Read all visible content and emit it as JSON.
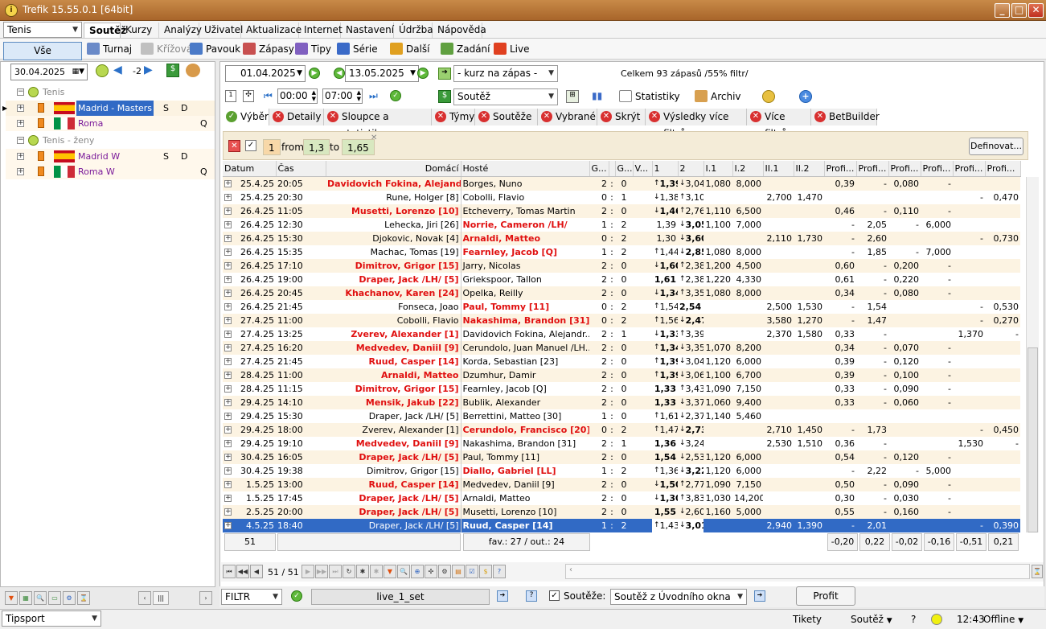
{
  "window": {
    "title": "Trefik 15.55.0.1 [64bit]",
    "min": "_",
    "max": "□",
    "close": "✕"
  },
  "sport_select": "Tenis",
  "menu": [
    "Soutěž",
    "Kurzy",
    "Analýzy",
    "Uživatel",
    "Aktualizace",
    "Internet",
    "Nastavení",
    "Údržba",
    "Nápověda"
  ],
  "toolbar": {
    "vse": "Vše",
    "items": [
      "Turnaj",
      "Křížová",
      "Pavouk",
      "Zápasy",
      "Tipy",
      "Série",
      "Další",
      "Zadání",
      "Live"
    ]
  },
  "left": {
    "date": "30.04.2025",
    "offset": "-2",
    "groups": [
      {
        "name": "Tenis",
        "items": [
          {
            "name": "Madrid - Masters",
            "s": "S",
            "d": "D",
            "flag": "es",
            "selected": true
          },
          {
            "name": "Roma",
            "s": "",
            "d": "Q",
            "flag": "it"
          }
        ]
      },
      {
        "name": "Tenis - ženy",
        "items": [
          {
            "name": "Madrid W",
            "s": "S",
            "d": "D",
            "flag": "es"
          },
          {
            "name": "Roma W",
            "s": "",
            "d": "Q",
            "flag": "it"
          }
        ]
      }
    ]
  },
  "filterbar": {
    "date_from": "01.04.2025",
    "date_to": "13.05.2025",
    "kurz": "- kurz na zápas -",
    "summary": "Celkem 93 zápasů /55% filtr/",
    "time_from": "00:00",
    "time_to": "07:00",
    "soutez": "Soutěž",
    "statistiky": "Statistiky",
    "archiv": "Archiv"
  },
  "tabs": [
    "Výběr",
    "Detaily",
    "Sloupce a statistiky",
    "Týmy",
    "Soutěže",
    "Vybrané",
    "Skrýt",
    "Výsledky více filtrů",
    "Více filtrů",
    "BetBuilder"
  ],
  "filter": {
    "num": "1",
    "from": "from",
    "v1": "1,3",
    "to": "to",
    "v2": "1,65",
    "define": "Definovat..."
  },
  "columns": [
    "Datum",
    "Čas",
    "Domácí",
    "Hosté",
    "G...",
    "",
    "G...",
    "V...",
    "1",
    "2",
    "I.1",
    "I.2",
    "II.1",
    "II.2",
    "Profi...",
    "Profi...",
    "Profi...",
    "Profi...",
    "Profi...",
    "Profi..."
  ],
  "rows": [
    {
      "date": "25.4.25",
      "time": "20:05",
      "home": "Davidovich Fokina, Alejandr...",
      "away": "Borges, Nuno",
      "hb": true,
      "ab": false,
      "g1": "2",
      "g2": "0",
      "o1": "1,39",
      "o1b": true,
      "a1": "↑",
      "o2": "3,04",
      "a2": "↓",
      "o2b": false,
      "i1": "1,080",
      "i2": "8,000",
      "ii1": "",
      "ii2": "",
      "p": [
        "0,39",
        "-",
        "0,080",
        "-",
        "",
        ""
      ]
    },
    {
      "date": "25.4.25",
      "time": "20:30",
      "home": "Rune, Holger [8]",
      "away": "Cobolli, Flavio",
      "hb": false,
      "ab": false,
      "g1": "0",
      "g2": "1",
      "o1": "1,38",
      "o1b": false,
      "a1": "↓",
      "o2": "3,10",
      "a2": "↑",
      "o2b": false,
      "i1": "",
      "i2": "",
      "ii1": "2,700",
      "ii2": "1,470",
      "p": [
        "",
        "",
        "",
        "",
        "-",
        "0,470"
      ]
    },
    {
      "date": "26.4.25",
      "time": "11:05",
      "home": "Musetti, Lorenzo [10]",
      "away": "Etcheverry, Tomas Martin",
      "hb": true,
      "ab": false,
      "g1": "2",
      "g2": "0",
      "o1": "1,46",
      "o1b": true,
      "a1": "↓",
      "o2": "2,76",
      "a2": "↑",
      "o2b": false,
      "i1": "1,110",
      "i2": "6,500",
      "ii1": "",
      "ii2": "",
      "p": [
        "0,46",
        "-",
        "0,110",
        "-",
        "",
        ""
      ]
    },
    {
      "date": "26.4.25",
      "time": "12:30",
      "home": "Lehecka, Jiri [26]",
      "away": "Norrie, Cameron /LH/",
      "hb": false,
      "ab": true,
      "g1": "1",
      "g2": "2",
      "o1": "1,39",
      "o1b": false,
      "a1": "",
      "o2": "3,05",
      "a2": "↓",
      "o2b": true,
      "i1": "1,100",
      "i2": "7,000",
      "ii1": "",
      "ii2": "",
      "p": [
        "-",
        "2,05",
        "-",
        "6,000",
        "",
        ""
      ]
    },
    {
      "date": "26.4.25",
      "time": "15:30",
      "home": "Djokovic, Novak [4]",
      "away": "Arnaldi, Matteo",
      "hb": false,
      "ab": true,
      "g1": "0",
      "g2": "2",
      "o1": "1,30",
      "o1b": false,
      "a1": "",
      "o2": "3,60",
      "a2": "↓",
      "o2b": true,
      "i1": "",
      "i2": "",
      "ii1": "2,110",
      "ii2": "1,730",
      "p": [
        "-",
        "2,60",
        "",
        "",
        "-",
        "0,730"
      ]
    },
    {
      "date": "26.4.25",
      "time": "15:35",
      "home": "Machac, Tomas [19]",
      "away": "Fearnley, Jacob [Q]",
      "hb": false,
      "ab": true,
      "g1": "1",
      "g2": "2",
      "o1": "1,44",
      "o1b": false,
      "a1": "↑",
      "o2": "2,85",
      "a2": "↓",
      "o2b": true,
      "i1": "1,080",
      "i2": "8,000",
      "ii1": "",
      "ii2": "",
      "p": [
        "-",
        "1,85",
        "-",
        "7,000",
        "",
        ""
      ]
    },
    {
      "date": "26.4.25",
      "time": "17:10",
      "home": "Dimitrov, Grigor [15]",
      "away": "Jarry, Nicolas",
      "hb": true,
      "ab": false,
      "g1": "2",
      "g2": "0",
      "o1": "1,60",
      "o1b": true,
      "a1": "↓",
      "o2": "2,38",
      "a2": "↑",
      "o2b": false,
      "i1": "1,200",
      "i2": "4,500",
      "ii1": "",
      "ii2": "",
      "p": [
        "0,60",
        "-",
        "0,200",
        "-",
        "",
        ""
      ]
    },
    {
      "date": "26.4.25",
      "time": "19:00",
      "home": "Draper, Jack /LH/ [5]",
      "away": "Griekspoor, Tallon",
      "hb": true,
      "ab": false,
      "g1": "2",
      "g2": "0",
      "o1": "1,61",
      "o1b": true,
      "a1": "",
      "o2": "2,38",
      "a2": "↑",
      "o2b": false,
      "i1": "1,220",
      "i2": "4,330",
      "ii1": "",
      "ii2": "",
      "p": [
        "0,61",
        "-",
        "0,220",
        "-",
        "",
        ""
      ]
    },
    {
      "date": "26.4.25",
      "time": "20:45",
      "home": "Khachanov, Karen [24]",
      "away": "Opelka, Reilly",
      "hb": true,
      "ab": false,
      "g1": "2",
      "g2": "0",
      "o1": "1,34",
      "o1b": true,
      "a1": "↓",
      "o2": "3,35",
      "a2": "↑",
      "o2b": false,
      "i1": "1,080",
      "i2": "8,000",
      "ii1": "",
      "ii2": "",
      "p": [
        "0,34",
        "-",
        "0,080",
        "-",
        "",
        ""
      ]
    },
    {
      "date": "26.4.25",
      "time": "21:45",
      "home": "Fonseca, Joao",
      "away": "Paul, Tommy [11]",
      "hb": false,
      "ab": true,
      "g1": "0",
      "g2": "2",
      "o1": "1,54",
      "o1b": false,
      "a1": "↑",
      "o2": "2,54",
      "a2": "",
      "o2b": true,
      "i1": "",
      "i2": "",
      "ii1": "2,500",
      "ii2": "1,530",
      "p": [
        "-",
        "1,54",
        "",
        "",
        "-",
        "0,530"
      ]
    },
    {
      "date": "27.4.25",
      "time": "11:00",
      "home": "Cobolli, Flavio",
      "away": "Nakashima, Brandon [31]",
      "hb": false,
      "ab": true,
      "g1": "0",
      "g2": "2",
      "o1": "1,56",
      "o1b": false,
      "a1": "↑",
      "o2": "2,47",
      "a2": "↓",
      "o2b": true,
      "i1": "",
      "i2": "",
      "ii1": "3,580",
      "ii2": "1,270",
      "p": [
        "-",
        "1,47",
        "",
        "",
        "-",
        "0,270"
      ]
    },
    {
      "date": "27.4.25",
      "time": "13:25",
      "home": "Zverev, Alexander [1]",
      "away": "Davidovich Fokina, Alejandr...",
      "hb": true,
      "ab": false,
      "g1": "2",
      "g2": "1",
      "o1": "1,33",
      "o1b": true,
      "a1": "↓",
      "o2": "3,39",
      "a2": "↑",
      "o2b": false,
      "i1": "",
      "i2": "",
      "ii1": "2,370",
      "ii2": "1,580",
      "p": [
        "0,33",
        "-",
        "",
        "",
        "1,370",
        "-"
      ]
    },
    {
      "date": "27.4.25",
      "time": "16:20",
      "home": "Medvedev, Daniil [9]",
      "away": "Cerundolo, Juan Manuel /LH...",
      "hb": true,
      "ab": false,
      "g1": "2",
      "g2": "0",
      "o1": "1,34",
      "o1b": true,
      "a1": "↑",
      "o2": "3,35",
      "a2": "↓",
      "o2b": false,
      "i1": "1,070",
      "i2": "8,200",
      "ii1": "",
      "ii2": "",
      "p": [
        "0,34",
        "-",
        "0,070",
        "-",
        "",
        ""
      ]
    },
    {
      "date": "27.4.25",
      "time": "21:45",
      "home": "Ruud, Casper [14]",
      "away": "Korda, Sebastian [23]",
      "hb": true,
      "ab": false,
      "g1": "2",
      "g2": "0",
      "o1": "1,39",
      "o1b": true,
      "a1": "↑",
      "o2": "3,04",
      "a2": "↓",
      "o2b": false,
      "i1": "1,120",
      "i2": "6,000",
      "ii1": "",
      "ii2": "",
      "p": [
        "0,39",
        "-",
        "0,120",
        "-",
        "",
        ""
      ]
    },
    {
      "date": "28.4.25",
      "time": "11:00",
      "home": "Arnaldi, Matteo",
      "away": "Dzumhur, Damir",
      "hb": true,
      "ab": false,
      "g1": "2",
      "g2": "0",
      "o1": "1,39",
      "o1b": true,
      "a1": "↑",
      "o2": "3,06",
      "a2": "↓",
      "o2b": false,
      "i1": "1,100",
      "i2": "6,700",
      "ii1": "",
      "ii2": "",
      "p": [
        "0,39",
        "-",
        "0,100",
        "-",
        "",
        ""
      ]
    },
    {
      "date": "28.4.25",
      "time": "11:15",
      "home": "Dimitrov, Grigor [15]",
      "away": "Fearnley, Jacob [Q]",
      "hb": true,
      "ab": false,
      "g1": "2",
      "g2": "0",
      "o1": "1,33",
      "o1b": true,
      "a1": "",
      "o2": "3,43",
      "a2": "↑",
      "o2b": false,
      "i1": "1,090",
      "i2": "7,150",
      "ii1": "",
      "ii2": "",
      "p": [
        "0,33",
        "-",
        "0,090",
        "-",
        "",
        ""
      ]
    },
    {
      "date": "29.4.25",
      "time": "14:10",
      "home": "Mensik, Jakub [22]",
      "away": "Bublik, Alexander",
      "hb": true,
      "ab": false,
      "g1": "2",
      "g2": "0",
      "o1": "1,33",
      "o1b": true,
      "a1": "",
      "o2": "3,37",
      "a2": "↓",
      "o2b": false,
      "i1": "1,060",
      "i2": "9,400",
      "ii1": "",
      "ii2": "",
      "p": [
        "0,33",
        "-",
        "0,060",
        "-",
        "",
        ""
      ]
    },
    {
      "date": "29.4.25",
      "time": "15:30",
      "home": "Draper, Jack /LH/ [5]",
      "away": "Berrettini, Matteo [30]",
      "hb": false,
      "ab": false,
      "g1": "1",
      "g2": "0",
      "o1": "1,61",
      "o1b": false,
      "a1": "↑",
      "o2": "2,37",
      "a2": "↓",
      "o2b": false,
      "i1": "1,140",
      "i2": "5,460",
      "ii1": "",
      "ii2": "",
      "p": [
        "",
        "",
        "",
        "",
        "",
        ""
      ]
    },
    {
      "date": "29.4.25",
      "time": "18:00",
      "home": "Zverev, Alexander [1]",
      "away": "Cerundolo, Francisco [20]",
      "hb": false,
      "ab": true,
      "g1": "0",
      "g2": "2",
      "o1": "1,47",
      "o1b": false,
      "a1": "↑",
      "o2": "2,73",
      "a2": "↓",
      "o2b": true,
      "i1": "",
      "i2": "",
      "ii1": "2,710",
      "ii2": "1,450",
      "p": [
        "-",
        "1,73",
        "",
        "",
        "-",
        "0,450"
      ]
    },
    {
      "date": "29.4.25",
      "time": "19:10",
      "home": "Medvedev, Daniil [9]",
      "away": "Nakashima, Brandon [31]",
      "hb": true,
      "ab": false,
      "g1": "2",
      "g2": "1",
      "o1": "1,36",
      "o1b": true,
      "a1": "",
      "o2": "3,24",
      "a2": "↓",
      "o2b": false,
      "i1": "",
      "i2": "",
      "ii1": "2,530",
      "ii2": "1,510",
      "p": [
        "0,36",
        "-",
        "",
        "",
        "1,530",
        "-"
      ]
    },
    {
      "date": "30.4.25",
      "time": "16:05",
      "home": "Draper, Jack /LH/ [5]",
      "away": "Paul, Tommy [11]",
      "hb": true,
      "ab": false,
      "g1": "2",
      "g2": "0",
      "o1": "1,54",
      "o1b": true,
      "a1": "",
      "o2": "2,53",
      "a2": "↓",
      "o2b": false,
      "i1": "1,120",
      "i2": "6,000",
      "ii1": "",
      "ii2": "",
      "p": [
        "0,54",
        "-",
        "0,120",
        "-",
        "",
        ""
      ]
    },
    {
      "date": "30.4.25",
      "time": "19:38",
      "home": "Dimitrov, Grigor [15]",
      "away": "Diallo, Gabriel [LL]",
      "hb": false,
      "ab": true,
      "g1": "1",
      "g2": "2",
      "o1": "1,36",
      "o1b": false,
      "a1": "↑",
      "o2": "3,22",
      "a2": "↓",
      "o2b": true,
      "i1": "1,120",
      "i2": "6,000",
      "ii1": "",
      "ii2": "",
      "p": [
        "-",
        "2,22",
        "-",
        "5,000",
        "",
        ""
      ]
    },
    {
      "date": "1.5.25",
      "time": "13:00",
      "home": "Ruud, Casper [14]",
      "away": "Medvedev, Daniil [9]",
      "hb": true,
      "ab": false,
      "g1": "2",
      "g2": "0",
      "o1": "1,50",
      "o1b": true,
      "a1": "↓",
      "o2": "2,77",
      "a2": "↑",
      "o2b": false,
      "i1": "1,090",
      "i2": "7,150",
      "ii1": "",
      "ii2": "",
      "p": [
        "0,50",
        "-",
        "0,090",
        "-",
        "",
        ""
      ]
    },
    {
      "date": "1.5.25",
      "time": "17:45",
      "home": "Draper, Jack /LH/ [5]",
      "away": "Arnaldi, Matteo",
      "hb": true,
      "ab": false,
      "g1": "2",
      "g2": "0",
      "o1": "1,30",
      "o1b": true,
      "a1": "↓",
      "o2": "3,83",
      "a2": "↑",
      "o2b": false,
      "i1": "1,030",
      "i2": "14,200",
      "ii1": "",
      "ii2": "",
      "p": [
        "0,30",
        "-",
        "0,030",
        "-",
        "",
        ""
      ]
    },
    {
      "date": "2.5.25",
      "time": "20:00",
      "home": "Draper, Jack /LH/ [5]",
      "away": "Musetti, Lorenzo [10]",
      "hb": true,
      "ab": false,
      "g1": "2",
      "g2": "0",
      "o1": "1,55",
      "o1b": true,
      "a1": "",
      "o2": "2,60",
      "a2": "↓",
      "o2b": false,
      "i1": "1,160",
      "i2": "5,000",
      "ii1": "",
      "ii2": "",
      "p": [
        "0,55",
        "-",
        "0,160",
        "-",
        "",
        ""
      ]
    },
    {
      "date": "4.5.25",
      "time": "18:40",
      "home": "Draper, Jack /LH/ [5]",
      "away": "Ruud, Casper [14]",
      "hb": false,
      "ab": true,
      "g1": "1",
      "g2": "2",
      "o1": "1,43",
      "o1b": false,
      "a1": "↑",
      "o2": "3,01",
      "a2": "↓",
      "o2b": true,
      "i1": "",
      "i2": "",
      "ii1": "2,940",
      "ii2": "1,390",
      "p": [
        "-",
        "2,01",
        "",
        "",
        "-",
        "0,390"
      ],
      "selected": true
    }
  ],
  "footer": {
    "count": "51",
    "fav": "fav.: 27 / out.: 24",
    "sums": [
      "-0,20",
      "0,22",
      "-0,02",
      "-0,16",
      "-0,51",
      "0,21"
    ]
  },
  "nav": {
    "pos": "51 / 51"
  },
  "bottom": {
    "filtr": "FILTR",
    "live": "live_1_set",
    "soutez_label": "Soutěže:",
    "soutez_sel": "Soutěž z Úvodního okna",
    "profit": "Profit"
  },
  "status": {
    "bookmaker": "Tipsport",
    "tikety": "Tikety",
    "soutez": "Soutěž",
    "q": "?",
    "time": "12:43",
    "offline": "Offline"
  }
}
